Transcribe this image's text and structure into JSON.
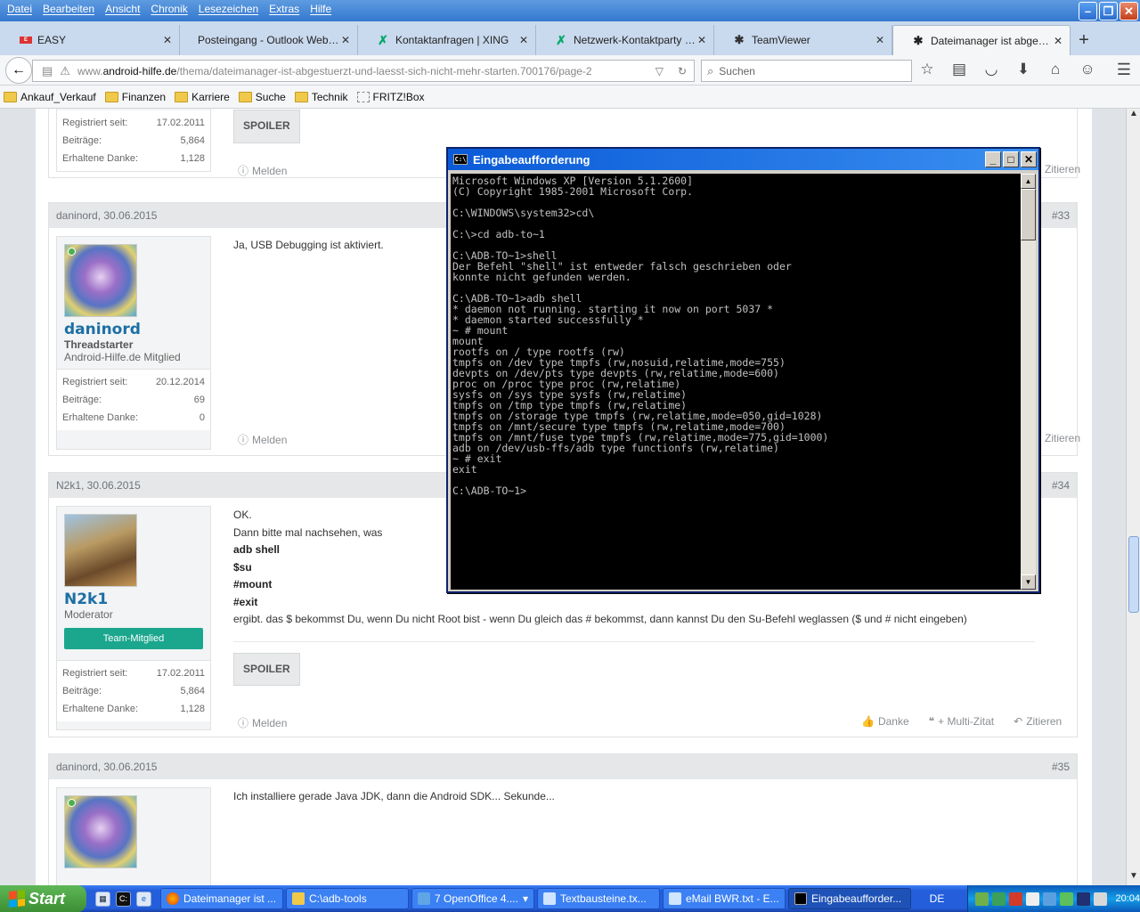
{
  "menubar": {
    "items": [
      "Datei",
      "Bearbeiten",
      "Ansicht",
      "Chronik",
      "Lesezeichen",
      "Extras",
      "Hilfe"
    ]
  },
  "tabs": [
    {
      "label": "EASY",
      "icon": "easy-icon"
    },
    {
      "label": "Posteingang - Outlook Web Acce...",
      "icon": "blank-icon"
    },
    {
      "label": "Kontaktanfragen | XING",
      "icon": "xing-icon"
    },
    {
      "label": "Netzwerk-Kontaktparty am ...",
      "icon": "xing-icon"
    },
    {
      "label": "TeamViewer",
      "icon": "puzzle-icon"
    },
    {
      "label": "Dateimanager ist abgestürz...",
      "icon": "android-icon"
    }
  ],
  "address": {
    "prefix": "www.",
    "domain": "android-hilfe.de",
    "path": "/thema/dateimanager-ist-abgestuerzt-und-laesst-sich-nicht-mehr-starten.700176/page-2"
  },
  "search": {
    "placeholder": "Suchen"
  },
  "bookmarks": [
    "Ankauf_Verkauf",
    "Finanzen",
    "Karriere",
    "Suche",
    "Technik",
    "FRITZ!Box"
  ],
  "stats_labels": {
    "registered": "Registriert seit:",
    "posts": "Beiträge:",
    "thanks": "Erhaltene Danke:"
  },
  "actions": {
    "report": "Melden",
    "thanks": "Danke",
    "multiquote": "+ Multi-Zitat",
    "quote": "Zitieren"
  },
  "posts": {
    "top": {
      "registered": "17.02.2011",
      "posts": "5,864",
      "thanks": "1,128",
      "spoiler": "SPOILER"
    },
    "p33": {
      "header": "daninord, 30.06.2015",
      "number": "#33",
      "user": "daninord",
      "role": "Threadstarter",
      "sub": "Android-Hilfe.de Mitglied",
      "registered": "20.12.2014",
      "posts": "69",
      "thanks": "0",
      "text": "Ja, USB Debugging ist aktiviert."
    },
    "p34": {
      "header": "N2k1, 30.06.2015",
      "number": "#34",
      "user": "N2k1",
      "role": "Moderator",
      "badge": "Team-Mitglied",
      "registered": "17.02.2011",
      "posts": "5,864",
      "thanks": "1,128",
      "line1": "OK.",
      "line2": "Dann bitte mal nachsehen, was",
      "code1": "adb shell",
      "code2": "$su",
      "code3": "#mount",
      "code4": "#exit",
      "line3": "ergibt. das $ bekommst Du, wenn Du nicht Root bist - wenn Du gleich das # bekommst, dann kannst Du den Su-Befehl weglassen ($ und # nicht eingeben)",
      "spoiler": "SPOILER"
    },
    "p35": {
      "header": "daninord, 30.06.2015",
      "number": "#35",
      "text": "Ich installiere gerade Java JDK, dann die Android SDK... Sekunde..."
    }
  },
  "cmd": {
    "title": "Eingabeaufforderung",
    "output": "Microsoft Windows XP [Version 5.1.2600]\n(C) Copyright 1985-2001 Microsoft Corp.\n\nC:\\WINDOWS\\system32>cd\\\n\nC:\\>cd adb-to~1\n\nC:\\ADB-TO~1>shell\nDer Befehl \"shell\" ist entweder falsch geschrieben oder\nkonnte nicht gefunden werden.\n\nC:\\ADB-TO~1>adb shell\n* daemon not running. starting it now on port 5037 *\n* daemon started successfully *\n~ # mount\nmount\nrootfs on / type rootfs (rw)\ntmpfs on /dev type tmpfs (rw,nosuid,relatime,mode=755)\ndevpts on /dev/pts type devpts (rw,relatime,mode=600)\nproc on /proc type proc (rw,relatime)\nsysfs on /sys type sysfs (rw,relatime)\ntmpfs on /tmp type tmpfs (rw,relatime)\ntmpfs on /storage type tmpfs (rw,relatime,mode=050,gid=1028)\ntmpfs on /mnt/secure type tmpfs (rw,relatime,mode=700)\ntmpfs on /mnt/fuse type tmpfs (rw,relatime,mode=775,gid=1000)\nadb on /dev/usb-ffs/adb type functionfs (rw,relatime)\n~ # exit\nexit\n\nC:\\ADB-TO~1>"
  },
  "taskbar": {
    "start": "Start",
    "items": [
      {
        "label": "Dateimanager ist ..."
      },
      {
        "label": "C:\\adb-tools"
      },
      {
        "label": "7 OpenOffice 4...."
      },
      {
        "label": "Textbausteine.tx..."
      },
      {
        "label": "eMail BWR.txt - E..."
      },
      {
        "label": "Eingabeaufforder..."
      }
    ],
    "lang": "DE",
    "clock": "20:04"
  }
}
